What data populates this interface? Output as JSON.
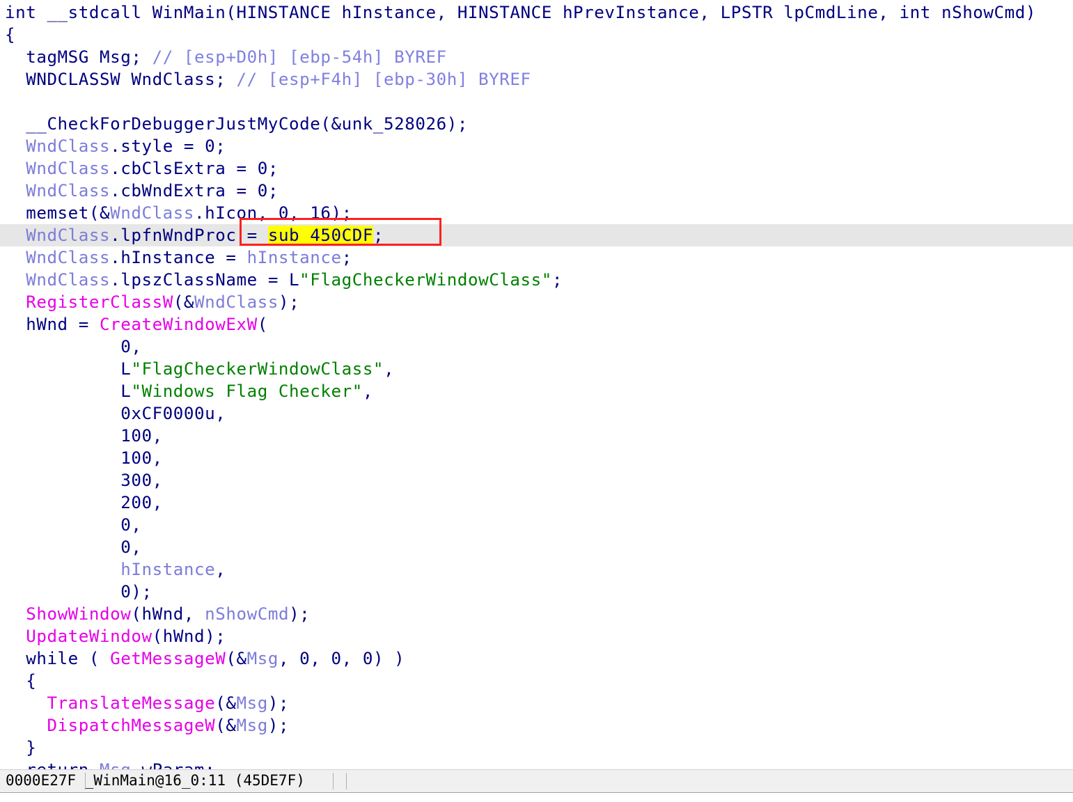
{
  "pseudocode": {
    "highlight_color": "#ffff00",
    "current_line_color": "#e6e6e6",
    "annotation_color": "#ff2020",
    "current_line_index": 10,
    "lines": [
      [
        {
          "t": "int __stdcall WinMain(HINSTANCE hInstance, HINSTANCE hPrevInstance, LPSTR lpCmdLine, int nShowCmd)",
          "c": "plain"
        }
      ],
      [
        {
          "t": "{",
          "c": "plain"
        }
      ],
      [
        {
          "t": "  tagMSG Msg; ",
          "c": "plain"
        },
        {
          "t": "// [esp+D0h] [ebp-54h] BYREF",
          "c": "cmt"
        }
      ],
      [
        {
          "t": "  WNDCLASSW WndClass; ",
          "c": "plain"
        },
        {
          "t": "// [esp+F4h] [ebp-30h] BYREF",
          "c": "cmt"
        }
      ],
      [
        {
          "t": "",
          "c": "plain"
        }
      ],
      [
        {
          "t": "  __CheckForDebuggerJustMyCode(&unk_528026);",
          "c": "plain"
        }
      ],
      [
        {
          "t": "  ",
          "c": "plain"
        },
        {
          "t": "WndClass",
          "c": "var"
        },
        {
          "t": ".style = 0;",
          "c": "plain"
        }
      ],
      [
        {
          "t": "  ",
          "c": "plain"
        },
        {
          "t": "WndClass",
          "c": "var"
        },
        {
          "t": ".cbClsExtra = 0;",
          "c": "plain"
        }
      ],
      [
        {
          "t": "  ",
          "c": "plain"
        },
        {
          "t": "WndClass",
          "c": "var"
        },
        {
          "t": ".cbWndExtra = 0;",
          "c": "plain"
        }
      ],
      [
        {
          "t": "  memset(&",
          "c": "plain"
        },
        {
          "t": "WndClass",
          "c": "var"
        },
        {
          "t": ".hIcon, 0, 16);",
          "c": "plain"
        }
      ],
      [
        {
          "t": "  ",
          "c": "plain"
        },
        {
          "t": "WndClass",
          "c": "var"
        },
        {
          "t": ".lpfnWndProc = ",
          "c": "plain"
        },
        {
          "t": "sub_450CDF",
          "c": "hl"
        },
        {
          "t": ";",
          "c": "plain"
        }
      ],
      [
        {
          "t": "  ",
          "c": "plain"
        },
        {
          "t": "WndClass",
          "c": "var"
        },
        {
          "t": ".hInstance = ",
          "c": "plain"
        },
        {
          "t": "hInstance",
          "c": "var"
        },
        {
          "t": ";",
          "c": "plain"
        }
      ],
      [
        {
          "t": "  ",
          "c": "plain"
        },
        {
          "t": "WndClass",
          "c": "var"
        },
        {
          "t": ".lpszClassName = L",
          "c": "plain"
        },
        {
          "t": "\"FlagCheckerWindowClass\"",
          "c": "str"
        },
        {
          "t": ";",
          "c": "plain"
        }
      ],
      [
        {
          "t": "  ",
          "c": "plain"
        },
        {
          "t": "RegisterClassW",
          "c": "call"
        },
        {
          "t": "(&",
          "c": "plain"
        },
        {
          "t": "WndClass",
          "c": "var"
        },
        {
          "t": ");",
          "c": "plain"
        }
      ],
      [
        {
          "t": "  hWnd = ",
          "c": "plain"
        },
        {
          "t": "CreateWindowExW",
          "c": "call"
        },
        {
          "t": "(",
          "c": "plain"
        }
      ],
      [
        {
          "t": "           0,",
          "c": "plain"
        }
      ],
      [
        {
          "t": "           L",
          "c": "plain"
        },
        {
          "t": "\"FlagCheckerWindowClass\"",
          "c": "str"
        },
        {
          "t": ",",
          "c": "plain"
        }
      ],
      [
        {
          "t": "           L",
          "c": "plain"
        },
        {
          "t": "\"Windows Flag Checker\"",
          "c": "str"
        },
        {
          "t": ",",
          "c": "plain"
        }
      ],
      [
        {
          "t": "           0xCF0000u,",
          "c": "plain"
        }
      ],
      [
        {
          "t": "           100,",
          "c": "plain"
        }
      ],
      [
        {
          "t": "           100,",
          "c": "plain"
        }
      ],
      [
        {
          "t": "           300,",
          "c": "plain"
        }
      ],
      [
        {
          "t": "           200,",
          "c": "plain"
        }
      ],
      [
        {
          "t": "           0,",
          "c": "plain"
        }
      ],
      [
        {
          "t": "           0,",
          "c": "plain"
        }
      ],
      [
        {
          "t": "           ",
          "c": "plain"
        },
        {
          "t": "hInstance",
          "c": "var"
        },
        {
          "t": ",",
          "c": "plain"
        }
      ],
      [
        {
          "t": "           0);",
          "c": "plain"
        }
      ],
      [
        {
          "t": "  ",
          "c": "plain"
        },
        {
          "t": "ShowWindow",
          "c": "call"
        },
        {
          "t": "(hWnd, ",
          "c": "plain"
        },
        {
          "t": "nShowCmd",
          "c": "var"
        },
        {
          "t": ");",
          "c": "plain"
        }
      ],
      [
        {
          "t": "  ",
          "c": "plain"
        },
        {
          "t": "UpdateWindow",
          "c": "call"
        },
        {
          "t": "(hWnd);",
          "c": "plain"
        }
      ],
      [
        {
          "t": "  while ( ",
          "c": "plain"
        },
        {
          "t": "GetMessageW",
          "c": "call"
        },
        {
          "t": "(&",
          "c": "plain"
        },
        {
          "t": "Msg",
          "c": "var"
        },
        {
          "t": ", 0, 0, 0) )",
          "c": "plain"
        }
      ],
      [
        {
          "t": "  {",
          "c": "plain"
        }
      ],
      [
        {
          "t": "    ",
          "c": "plain"
        },
        {
          "t": "TranslateMessage",
          "c": "call"
        },
        {
          "t": "(&",
          "c": "plain"
        },
        {
          "t": "Msg",
          "c": "var"
        },
        {
          "t": ");",
          "c": "plain"
        }
      ],
      [
        {
          "t": "    ",
          "c": "plain"
        },
        {
          "t": "DispatchMessageW",
          "c": "call"
        },
        {
          "t": "(&",
          "c": "plain"
        },
        {
          "t": "Msg",
          "c": "var"
        },
        {
          "t": ");",
          "c": "plain"
        }
      ],
      [
        {
          "t": "  }",
          "c": "plain"
        }
      ],
      [
        {
          "t": "  return ",
          "c": "plain"
        },
        {
          "t": "Msg",
          "c": "var"
        },
        {
          "t": ".wParam;",
          "c": "plain"
        }
      ]
    ]
  },
  "statusbar": {
    "location": "0000E27F _WinMain@16_0:11 (45DE7F)"
  }
}
